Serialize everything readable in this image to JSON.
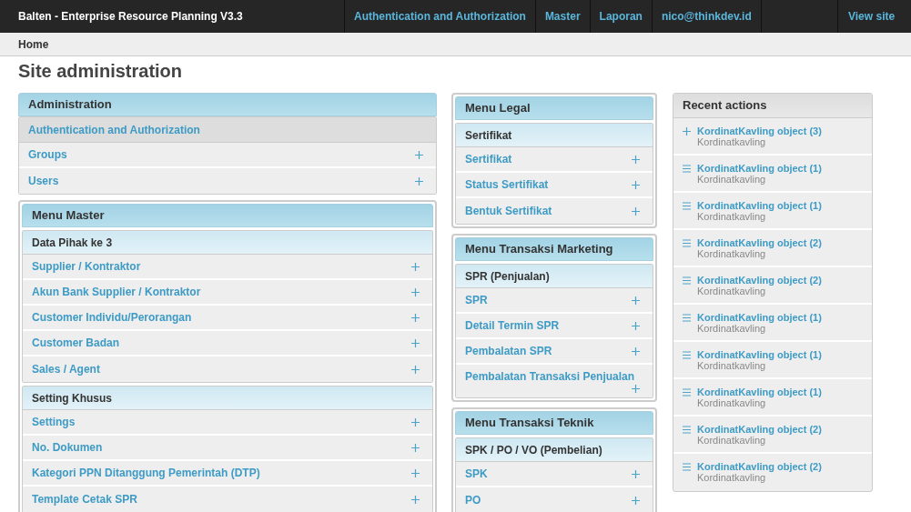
{
  "header": {
    "brand": "Balten - Enterprise Resource Planning V3.3",
    "nav": [
      "Authentication and Authorization",
      "Master",
      "Laporan",
      "nico@thinkdev.id"
    ],
    "view_site": "View site"
  },
  "breadcrumb": "Home",
  "title": "Site administration",
  "columns": [
    [
      {
        "title": "Administration",
        "framed": false,
        "sections": [
          {
            "kind": "app_link",
            "label": "Authentication and Authorization",
            "items": [
              "Groups",
              "Users"
            ]
          }
        ]
      },
      {
        "title": "Menu Master",
        "framed": true,
        "sections": [
          {
            "kind": "group",
            "label": "Data Pihak ke 3",
            "items": [
              "Supplier / Kontraktor",
              "Akun Bank Supplier / Kontraktor",
              "Customer Individu/Perorangan",
              "Customer Badan",
              "Sales / Agent"
            ]
          },
          {
            "kind": "group",
            "label": "Setting Khusus",
            "items": [
              "Settings",
              "No. Dokumen",
              "Kategori PPN Ditanggung Pemerintah (DTP)",
              "Template Cetak SPR"
            ]
          }
        ]
      }
    ],
    [
      {
        "title": "Menu Legal",
        "framed": true,
        "sections": [
          {
            "kind": "group",
            "label": "Sertifikat",
            "items": [
              "Sertifikat",
              "Status Sertifikat",
              "Bentuk Sertifikat"
            ]
          }
        ]
      },
      {
        "title": "Menu Transaksi Marketing",
        "framed": true,
        "sections": [
          {
            "kind": "group",
            "label": "SPR (Penjualan)",
            "items": [
              "SPR",
              "Detail Termin SPR",
              "Pembalatan SPR",
              "Pembalatan Transaksi Penjualan"
            ]
          }
        ]
      },
      {
        "title": "Menu Transaksi Teknik",
        "framed": true,
        "sections": [
          {
            "kind": "group",
            "label": "SPK / PO / VO (Pembelian)",
            "items": [
              "SPK",
              "PO"
            ]
          }
        ]
      }
    ]
  ],
  "recent_actions": {
    "title": "Recent actions",
    "items": [
      {
        "kind": "add",
        "object": "KordinatKavling object (3)",
        "model": "Kordinatkavling"
      },
      {
        "kind": "change",
        "object": "KordinatKavling object (1)",
        "model": "Kordinatkavling"
      },
      {
        "kind": "change",
        "object": "KordinatKavling object (1)",
        "model": "Kordinatkavling"
      },
      {
        "kind": "change",
        "object": "KordinatKavling object (2)",
        "model": "Kordinatkavling"
      },
      {
        "kind": "change",
        "object": "KordinatKavling object (2)",
        "model": "Kordinatkavling"
      },
      {
        "kind": "change",
        "object": "KordinatKavling object (1)",
        "model": "Kordinatkavling"
      },
      {
        "kind": "change",
        "object": "KordinatKavling object (1)",
        "model": "Kordinatkavling"
      },
      {
        "kind": "change",
        "object": "KordinatKavling object (1)",
        "model": "Kordinatkavling"
      },
      {
        "kind": "change",
        "object": "KordinatKavling object (2)",
        "model": "Kordinatkavling"
      },
      {
        "kind": "change",
        "object": "KordinatKavling object (2)",
        "model": "Kordinatkavling"
      }
    ]
  }
}
